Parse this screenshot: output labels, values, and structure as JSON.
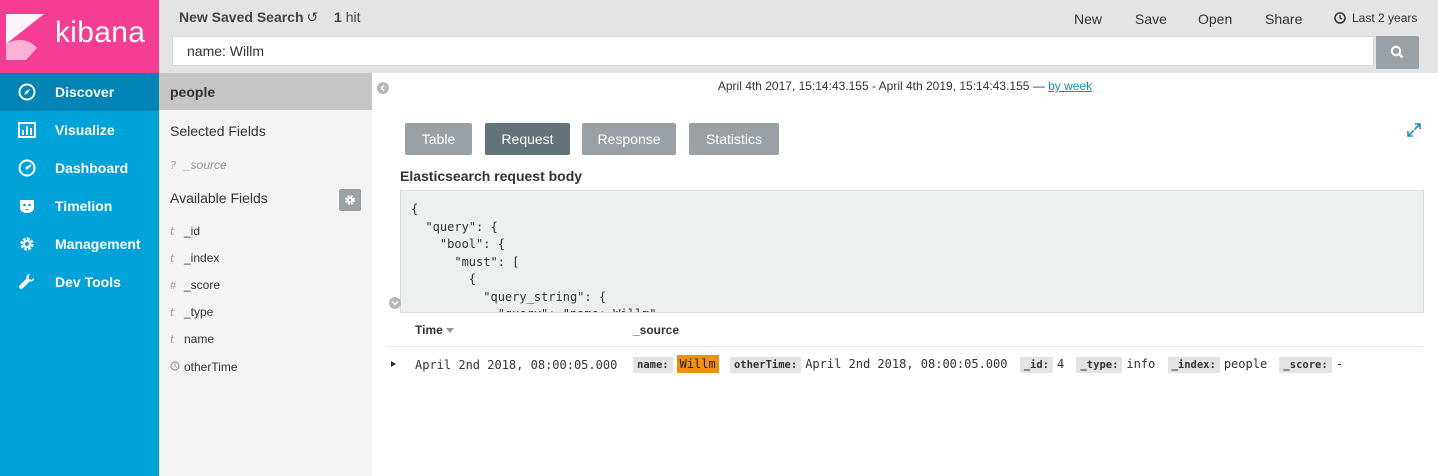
{
  "app": {
    "logo_text": "kibana",
    "brand_color": "#f53d93",
    "nav_color": "#00a3d9"
  },
  "nav": {
    "items": [
      {
        "label": "Discover",
        "icon": "compass-icon",
        "active": true
      },
      {
        "label": "Visualize",
        "icon": "bar-chart-icon"
      },
      {
        "label": "Dashboard",
        "icon": "dashboard-gauge-icon"
      },
      {
        "label": "Timelion",
        "icon": "timelion-icon"
      },
      {
        "label": "Management",
        "icon": "gear-icon"
      },
      {
        "label": "Dev Tools",
        "icon": "wrench-icon"
      }
    ]
  },
  "topbar": {
    "title": "New Saved Search",
    "reset_glyph": "↺",
    "hit_count": "1",
    "hit_label": "hit",
    "links": {
      "new": "New",
      "save": "Save",
      "open": "Open",
      "share": "Share"
    },
    "time_picker": "Last 2 years",
    "query": "name: Willm"
  },
  "sidebar": {
    "index_pattern": "people",
    "selected_heading": "Selected Fields",
    "selected_fields": [
      {
        "type": "?",
        "name": "_source"
      }
    ],
    "available_heading": "Available Fields",
    "available_fields": [
      {
        "type": "t",
        "name": "_id"
      },
      {
        "type": "t",
        "name": "_index"
      },
      {
        "type": "#",
        "name": "_score"
      },
      {
        "type": "t",
        "name": "_type"
      },
      {
        "type": "t",
        "name": "name"
      },
      {
        "type": "clock",
        "name": "otherTime"
      }
    ]
  },
  "main": {
    "time_range": "April 4th 2017, 15:14:43.155 - April 4th 2019, 15:14:43.155 —",
    "interval_link": "by week",
    "tabs": [
      {
        "label": "Table"
      },
      {
        "label": "Request",
        "active": true
      },
      {
        "label": "Response"
      },
      {
        "label": "Statistics"
      }
    ],
    "request_title": "Elasticsearch request body",
    "request_code": "{\n  \"query\": {\n    \"bool\": {\n      \"must\": [\n        {\n          \"query_string\": {\n            \"query\": \"name: Willm\","
  },
  "doc_table": {
    "col_time": "Time",
    "col_source": "_source",
    "row": {
      "time": "April 2nd 2018, 08:00:05.000",
      "fields": [
        {
          "key": "name:",
          "value": "Willm",
          "highlight": true
        },
        {
          "key": "otherTime:",
          "value": "April 2nd 2018, 08:00:05.000"
        },
        {
          "key": "_id:",
          "value": "4"
        },
        {
          "key": "_type:",
          "value": "info"
        },
        {
          "key": "_index:",
          "value": "people"
        },
        {
          "key": "_score:",
          "value": "-"
        }
      ]
    }
  }
}
